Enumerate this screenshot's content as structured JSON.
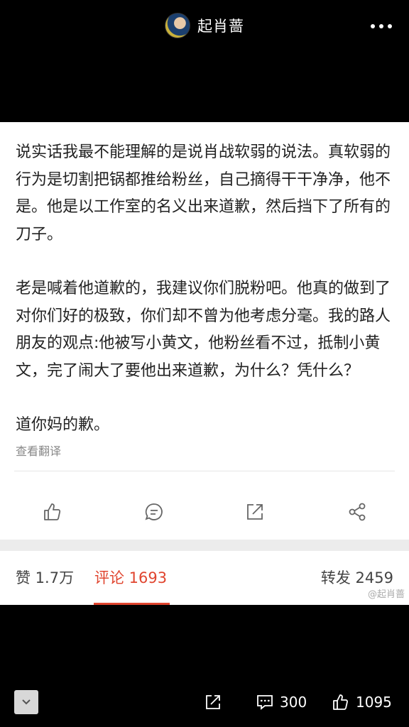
{
  "header": {
    "username": "起肖蔷",
    "more_icon": "more-dots-icon"
  },
  "post": {
    "paragraphs": [
      "说实话我最不能理解的是说肖战软弱的说法。真软弱的行为是切割把锅都推给粉丝，自己摘得干干净净，他不是。他是以工作室的名义出来道歉，然后挡下了所有的刀子。",
      "老是喊着他道歉的，我建议你们脱粉吧。他真的做到了对你们好的极致，你们却不曾为他考虑分毫。我的路人朋友的观点:他被写小黄文，他粉丝看不过，抵制小黄文，完了闹大了要他出来道歉，为什么？凭什么？",
      "道你妈的歉。"
    ],
    "translate_label": "查看翻译"
  },
  "actions": [
    "like-icon",
    "comment-icon",
    "repost-icon",
    "share-icon"
  ],
  "tabs": {
    "likes": "赞 1.7万",
    "comments": "评论 1693",
    "reposts": "转发 2459",
    "watermark": "@起肖蔷"
  },
  "bottom": {
    "comment_count": "300",
    "like_count": "1095"
  },
  "colors": {
    "accent": "#e0452f",
    "background_dark": "#000000"
  }
}
